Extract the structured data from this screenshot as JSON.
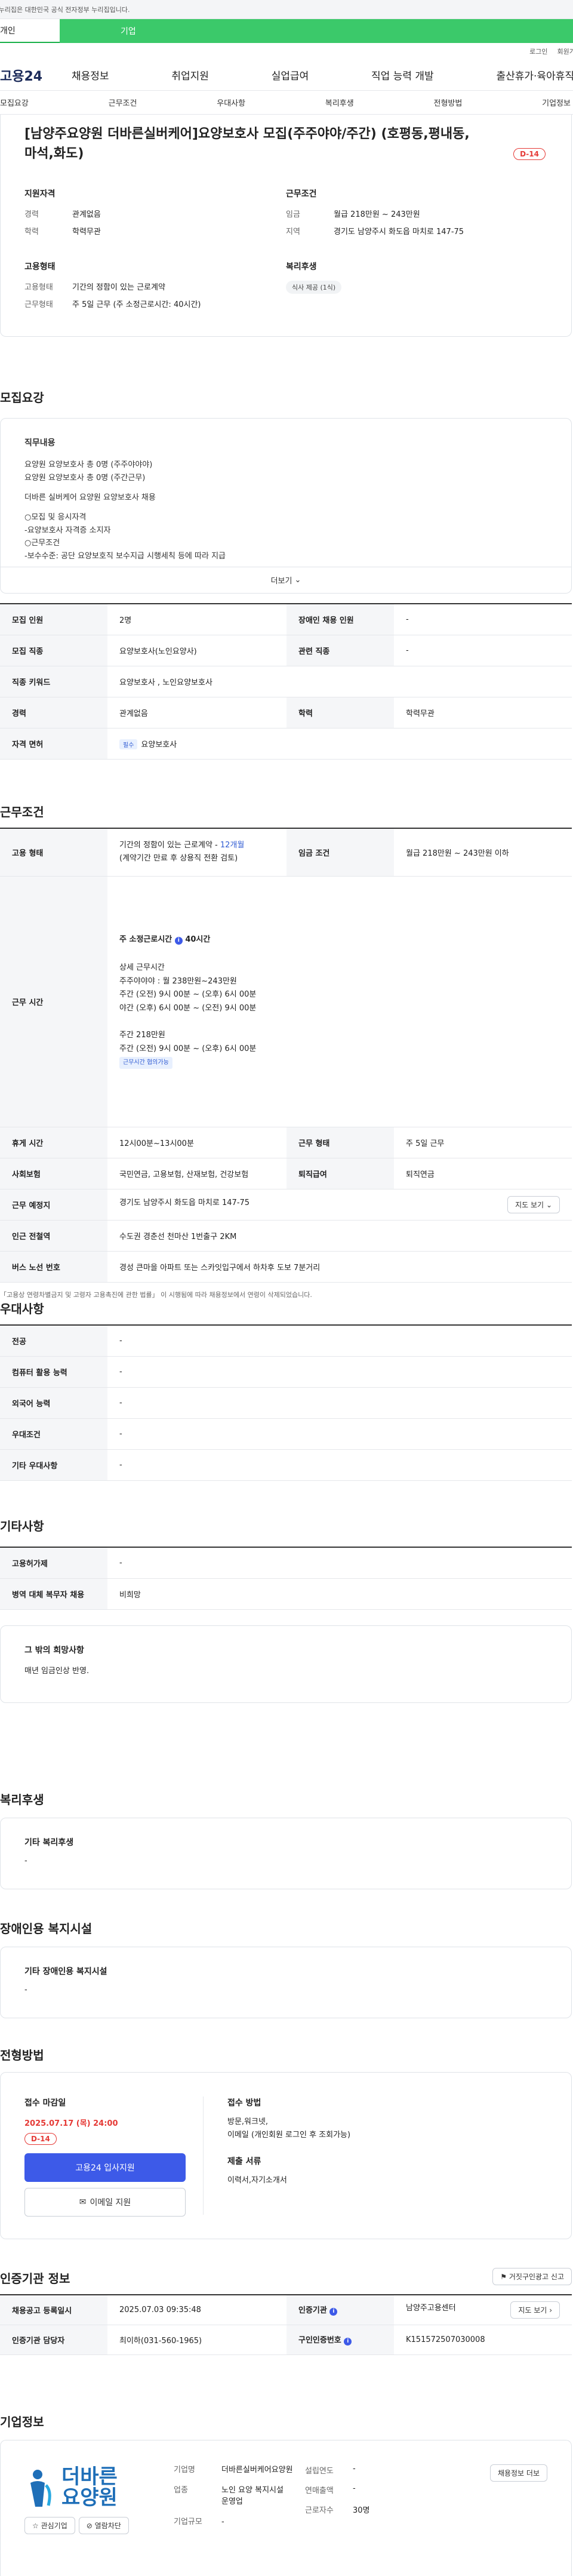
{
  "banner": "이 누리집은 대한민국 공식 전자정부 누리집입니다.",
  "top_tabs": [
    "개인",
    "기업"
  ],
  "util": [
    "로그인",
    "회원가입"
  ],
  "logo": "고용24",
  "gnb": [
    "채용정보",
    "취업지원",
    "실업급여",
    "직업 능력 개발",
    "출산휴가·육아휴직"
  ],
  "subnav": [
    "모집요강",
    "근무조건",
    "우대사항",
    "복리후생",
    "전형방법",
    "기업정보"
  ],
  "job": {
    "title": "[남양주요양원 더바른실버케어]요양보호사 모집(주주야야/주간) (호평동,평내동,마석,화도)",
    "dday": "D-14",
    "qual_h": "지원자격",
    "qual": [
      [
        "경력",
        "관계없음"
      ],
      [
        "학력",
        "학력무관"
      ]
    ],
    "work_h": "근무조건",
    "work": [
      [
        "임금",
        "월급 218만원 ~ 243만원"
      ],
      [
        "지역",
        "경기도 남양주시 화도읍 마치로 147-75"
      ]
    ],
    "emp_h": "고용형태",
    "emp": [
      [
        "고용형태",
        "기간의 정함이 있는 근로계약"
      ],
      [
        "근무형태",
        "주 5일 근무 (주 소정근로시간: 40시간)"
      ]
    ],
    "welfare_h": "복리후생",
    "welfare_pill": "식사 제공 (1식)"
  },
  "recruit": {
    "heading": "모집요강",
    "desc_h": "직무내용",
    "desc": [
      "요양원 요양보호사 총 0명 (주주야야야)",
      "요양원 요양보호사 총 0명 (주간근무)",
      "",
      "더바른 실버케어 요양원 요양보호사 채용",
      "",
      "○모집 및 응시자격",
      "-요양보호사 자격증 소지자",
      "○근무조건",
      "-보수수준: 공단 요양보호직 보수지급 시행세칙 등에 따라 지급"
    ],
    "more": "더보기",
    "rows": [
      {
        "k": "모집 인원",
        "v": "2명",
        "k2": "장애인 채용 인원",
        "v2": "-"
      },
      {
        "k": "모집 직종",
        "v": "요양보호사(노인요양사)",
        "k2": "관련 직종",
        "v2": "-"
      },
      {
        "k": "직종 키워드",
        "v": "요양보호사 , 노인요양보호사"
      },
      {
        "k": "경력",
        "v": "관계없음",
        "k2": "학력",
        "v2": "학력무관"
      },
      {
        "k": "자격 면허",
        "tag": "필수",
        "v": "요양보호사"
      }
    ]
  },
  "cond": {
    "heading": "근무조건",
    "emp_k": "고용 형태",
    "emp_v1": "기간의 정함이 있는 근로계약 - ",
    "emp_v1_b": "12개월",
    "emp_v2": "(계약기간 만료 후 상용직 전환 검토)",
    "wage_k": "임금 조건",
    "wage_v": "월급 218만원 ~ 243만원 이하",
    "time_k": "근무 시간",
    "time_total": "주 소정근로시간",
    "time_total_v": "40시간",
    "time_lines": [
      "상세 근무시간",
      "주주야야야 : 월 238만원~243만원",
      "주간 (오전) 9시 00분 ~ (오후) 6시 00분",
      "야간 (오후) 6시 00분 ~ (오전) 9시 00분",
      "",
      "주간 218만원",
      "주간 (오전) 9시 00분 ~ (오후) 6시 00분"
    ],
    "time_tag": "근무시간 협의가능",
    "rows": [
      {
        "k": "휴게 시간",
        "v": "12시00분~13시00분",
        "k2": "근무 형태",
        "v2": "주 5일 근무"
      },
      {
        "k": "사회보험",
        "v": "국민연금, 고용보험, 산재보험, 건강보험",
        "k2": "퇴직급여",
        "v2": "퇴직연금"
      },
      {
        "k": "근무 예정지",
        "v": "경기도 남양주시 화도읍 마치로 147-75",
        "btn": "지도 보기"
      },
      {
        "k": "인근 전철역",
        "v": "수도권 경춘선 천마산 1번출구 2KM"
      },
      {
        "k": "버스 노선 번호",
        "v": "경성 큰마을 아파트 또는 스카잇입구에서 하차후 도보 7분거리"
      }
    ],
    "note": "「고용상 연령차별금지 및 고령자 고용촉진에 관한 법률」 이 시행됨에 따라 채용정보에서 연령이 삭제되었습니다."
  },
  "pref": {
    "heading": "우대사항",
    "rows": [
      [
        "전공",
        "-"
      ],
      [
        "컴퓨터 활용 능력",
        "-"
      ],
      [
        "외국어 능력",
        "-"
      ],
      [
        "우대조건",
        "-"
      ],
      [
        "기타 우대사항",
        "-"
      ]
    ]
  },
  "etc": {
    "heading": "기타사항",
    "rows": [
      [
        "고용허가제",
        "-"
      ],
      [
        "병역 대체 복무자 채용",
        "비희망"
      ]
    ],
    "box_h": "그 밖의 희망사항",
    "box_v": "매년 임금인상 반영."
  },
  "welfare": {
    "heading": "복리후생",
    "box_h": "기타 복리후생",
    "box_v": "-"
  },
  "disabled": {
    "heading": "장애인용 복지시설",
    "box_h": "기타 장애인용 복지시설",
    "box_v": "-"
  },
  "process": {
    "heading": "전형방법",
    "deadline_h": "접수 마감일",
    "deadline": "2025.07.17 (목) 24:00",
    "dday": "D-14",
    "apply_btn": "고용24 입사지원",
    "email_btn": "이메일 지원",
    "method_h": "접수 방법",
    "method": [
      "방문,워크넷,",
      "이메일 (개인회원 로그인 후 조회가능)"
    ],
    "docs_h": "제출 서류",
    "docs": "이력서,자기소개서"
  },
  "cert": {
    "heading": "인증기관 정보",
    "report_btn": "거짓구인광고 신고",
    "rows": [
      {
        "k": "채용공고 등록일시",
        "v": "2025.07.03 09:35:48",
        "k2": "인증기관",
        "v2": "남양주고용센터",
        "btn": "지도 보기"
      },
      {
        "k": "인증기관 담당자",
        "v": "최이하(031-560-1965)",
        "k2": "구인인증번호",
        "v2": "K151572507030008"
      }
    ]
  },
  "company": {
    "heading": "기업정보",
    "logo_text": "더바른",
    "logo_sub": "요양원",
    "fav_btn": "관심기업",
    "block_btn": "열람차단",
    "info_btn": "채용정보 더보",
    "fields": [
      {
        "k": "기업명",
        "v": "더바른실버케어요양원"
      },
      {
        "k": "업종",
        "v": "노인 요양 복지시설 운영업"
      },
      {
        "k": "기업규모",
        "v": "-"
      }
    ],
    "fields2": [
      {
        "k": "설립연도",
        "v": "-"
      },
      {
        "k": "연매출액",
        "v": "-"
      },
      {
        "k": "근로자수",
        "v": "30명"
      }
    ]
  }
}
